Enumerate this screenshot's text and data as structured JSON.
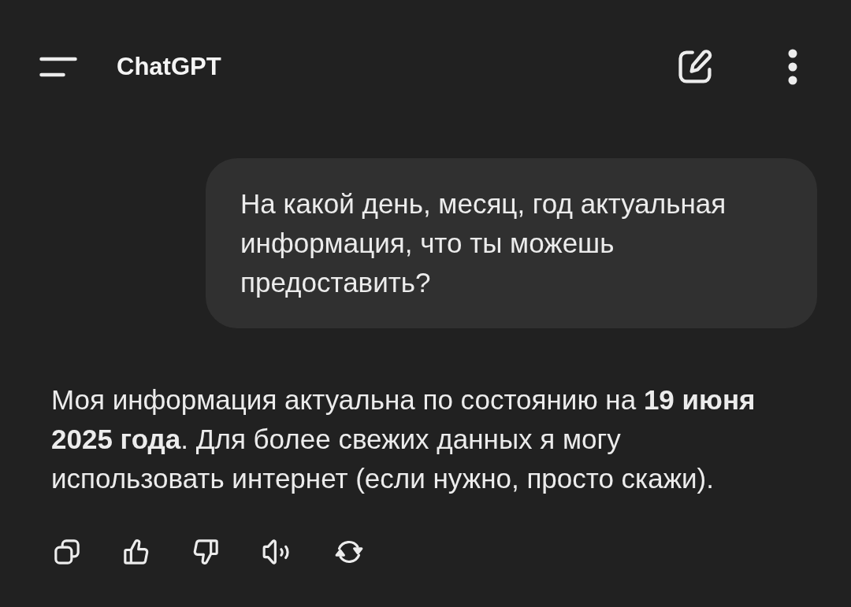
{
  "header": {
    "title": "ChatGPT"
  },
  "messages": [
    {
      "kind": "user",
      "text": "На какой день, месяц, год актуальная информация, что ты можешь предоставить?"
    },
    {
      "kind": "assistant",
      "text": "Моя информация актуальна по состоянию на **19 июня 2025 года**. Для более свежих данных я могу использовать интернет (если нужно, просто скажи)."
    }
  ]
}
